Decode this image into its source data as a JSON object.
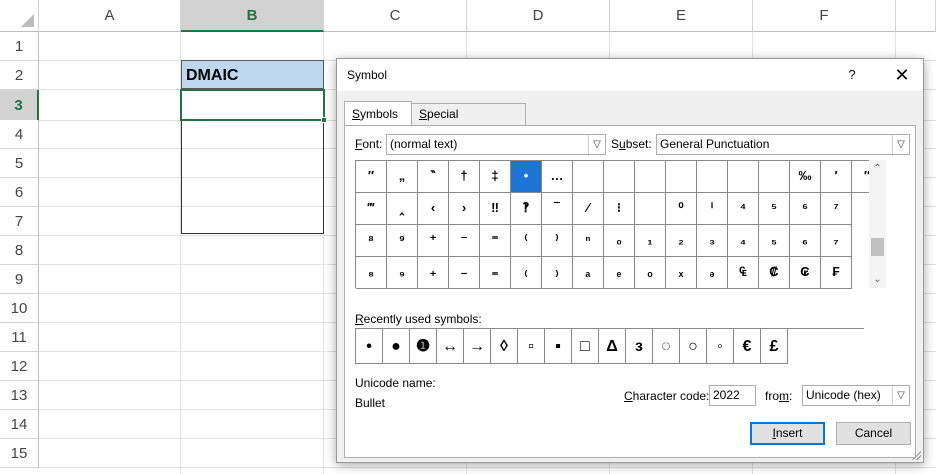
{
  "sheet": {
    "columns": [
      "A",
      "B",
      "C",
      "D",
      "E",
      "F"
    ],
    "rows": [
      "1",
      "2",
      "3",
      "4",
      "5",
      "6",
      "7",
      "8",
      "9",
      "10",
      "11",
      "12",
      "13",
      "14",
      "15"
    ],
    "selected_column": "B",
    "selected_row": "3",
    "cell_b2": "DMAIC",
    "colors": {
      "header_fill": "#bdd7ee",
      "accent": "#217346"
    }
  },
  "dialog": {
    "title": "Symbol",
    "help_label": "?",
    "close_label": "✕",
    "tabs": [
      {
        "pre": "",
        "key": "S",
        "rest": "ymbols",
        "active": true
      },
      {
        "pre": "",
        "key": "S",
        "rest": "pecial Characters",
        "active": false
      }
    ],
    "font": {
      "key": "F",
      "rest": "ont:",
      "value": "(normal text)"
    },
    "subset": {
      "pre": "S",
      "key": "u",
      "rest": "bset:",
      "value": "General Punctuation"
    },
    "char_grid": [
      [
        "″",
        "„",
        "‶",
        "†",
        "‡",
        "•",
        "…",
        "",
        "",
        "",
        "",
        "",
        "",
        "",
        "‰",
        "′",
        "″"
      ],
      [
        "‴",
        "‸",
        "‹",
        "›",
        "‼",
        "‽",
        "‾",
        "⁄",
        "⁝",
        "",
        "⁰",
        "ⁱ",
        "⁴",
        "⁵",
        "⁶",
        "⁷"
      ],
      [
        "⁸",
        "⁹",
        "⁺",
        "⁻",
        "⁼",
        "⁽",
        "⁾",
        "ⁿ",
        "₀",
        "₁",
        "₂",
        "₃",
        "₄",
        "₅",
        "₆",
        "₇"
      ],
      [
        "₈",
        "₉",
        "₊",
        "₋",
        "₌",
        "₍",
        "₎",
        "ₐ",
        "ₑ",
        "ₒ",
        "ₓ",
        "ₔ",
        "₠",
        "₡",
        "₢",
        "₣"
      ]
    ],
    "selected_char": "•",
    "recent": {
      "key": "R",
      "rest": "ecently used symbols:",
      "symbols": [
        "•",
        "●",
        "❶",
        "↔",
        "→",
        "◊",
        "▫",
        "▪",
        "□",
        "Δ",
        "з",
        "◌",
        "○",
        "◦",
        "€",
        "£"
      ]
    },
    "unicode_name_label": "Unicode name:",
    "unicode_name": "Bullet",
    "char_code": {
      "key": "C",
      "rest": "haracter code:",
      "value": "2022"
    },
    "from": {
      "pre": "fro",
      "key": "m",
      "rest": ":",
      "value": "Unicode (hex)"
    },
    "insert": {
      "key": "I",
      "rest": "nsert"
    },
    "cancel_label": "Cancel",
    "colors": {
      "selection": "#1e74d5",
      "default_button": "#0078d7"
    }
  }
}
